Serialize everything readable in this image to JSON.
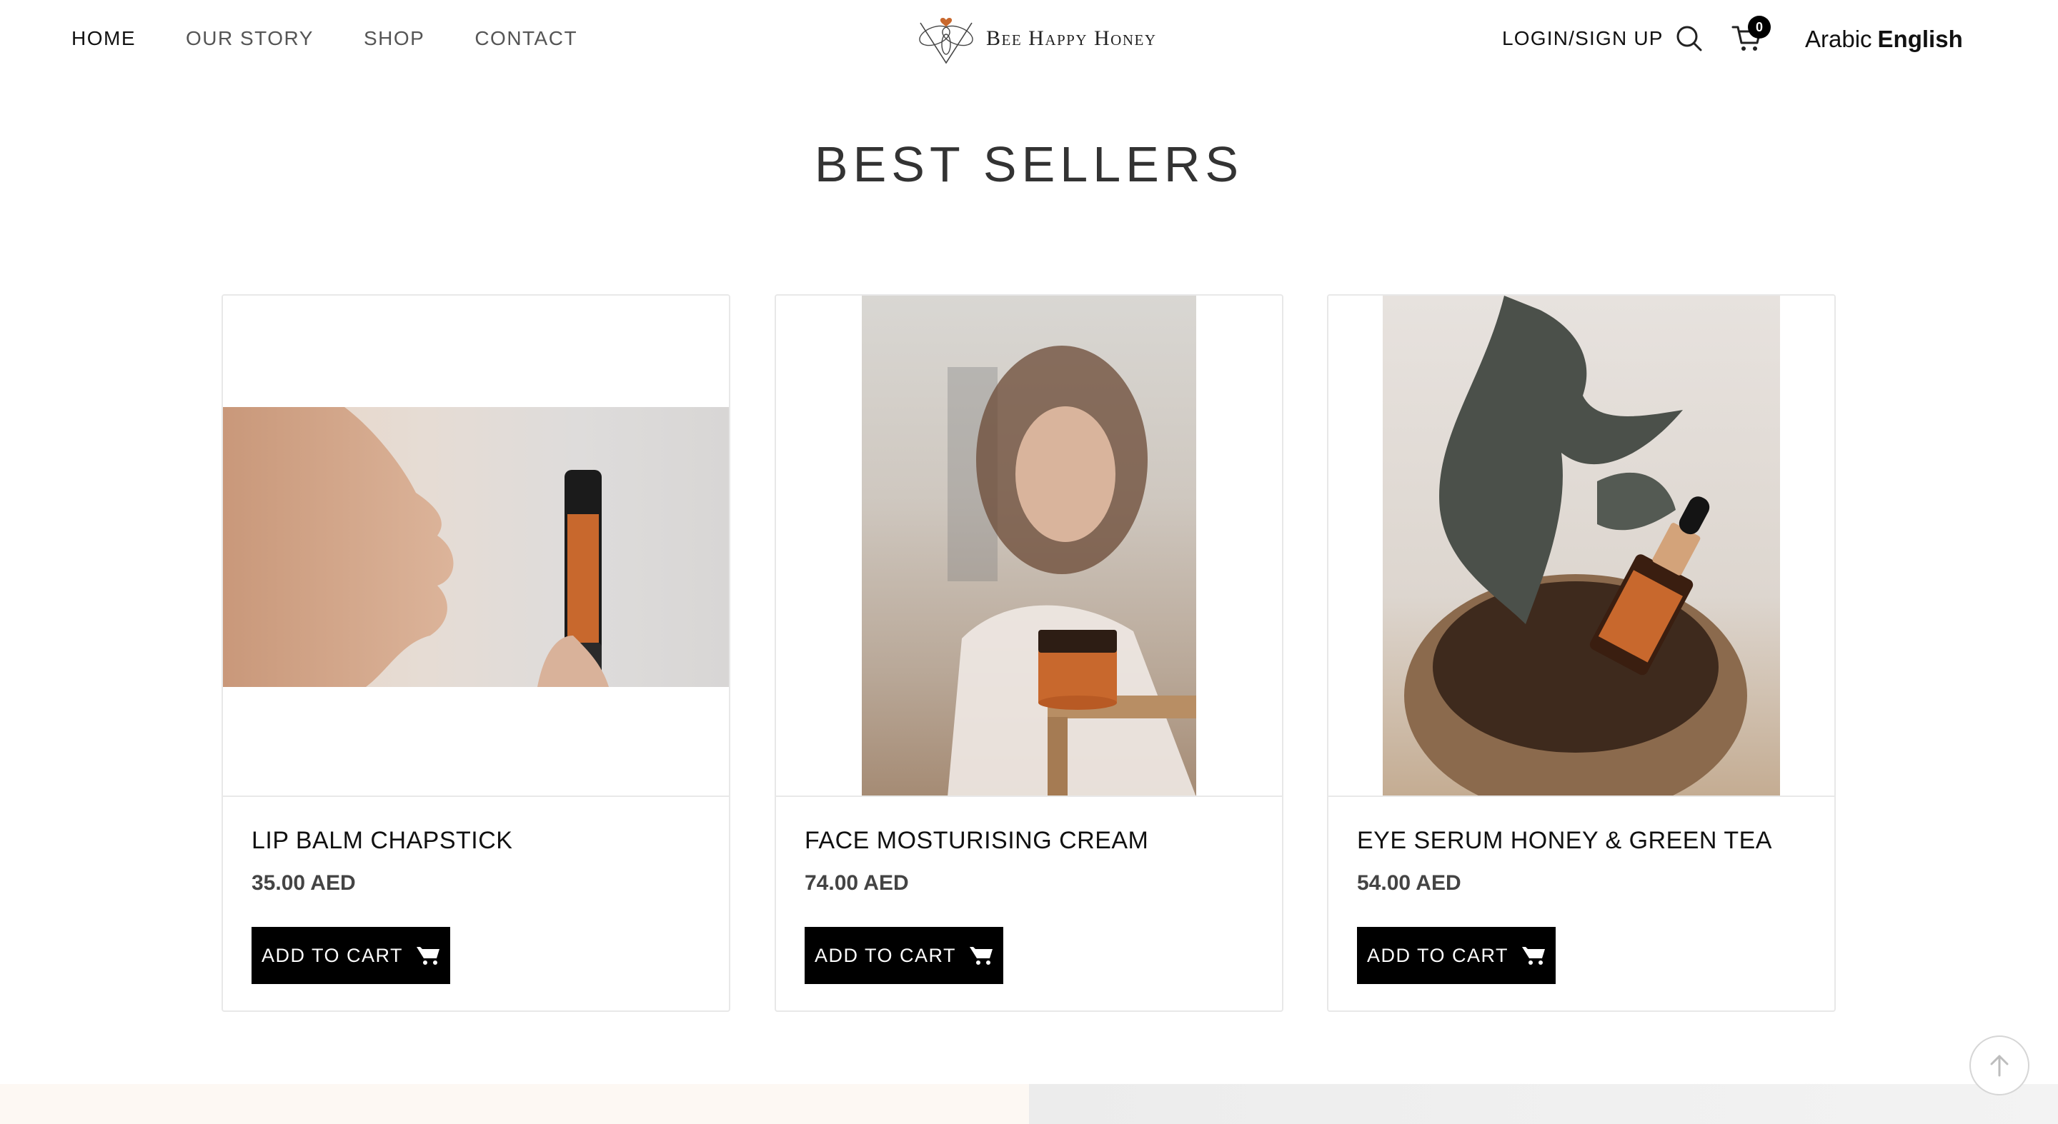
{
  "nav": {
    "items": [
      {
        "label": "HOME",
        "active": true
      },
      {
        "label": "OUR STORY",
        "active": false
      },
      {
        "label": "SHOP",
        "active": false
      },
      {
        "label": "CONTACT",
        "active": false
      }
    ]
  },
  "brand": {
    "name": "Bee Happy Honey",
    "logo_icon": "bee-heart-logo-icon"
  },
  "header": {
    "login_label": "LOGIN/SIGN UP",
    "search_icon": "search-icon",
    "cart_icon": "cart-icon",
    "cart_count": "0",
    "language": {
      "arabic": "Arabic",
      "english": "English",
      "selected": "English"
    }
  },
  "section": {
    "title": "BEST SELLERS"
  },
  "products": [
    {
      "name": "LIP BALM CHAPSTICK",
      "price": "35.00 AED",
      "button_label": "ADD TO CART"
    },
    {
      "name": "FACE MOSTURISING CREAM",
      "price": "74.00 AED",
      "button_label": "ADD TO CART"
    },
    {
      "name": "EYE SERUM HONEY & GREEN TEA",
      "price": "54.00 AED",
      "button_label": "ADD TO CART"
    }
  ],
  "colors": {
    "button_bg": "#000000",
    "button_text": "#ffffff",
    "product_accent": "#c8682d"
  },
  "scroll_to_top_icon": "arrow-up-icon"
}
